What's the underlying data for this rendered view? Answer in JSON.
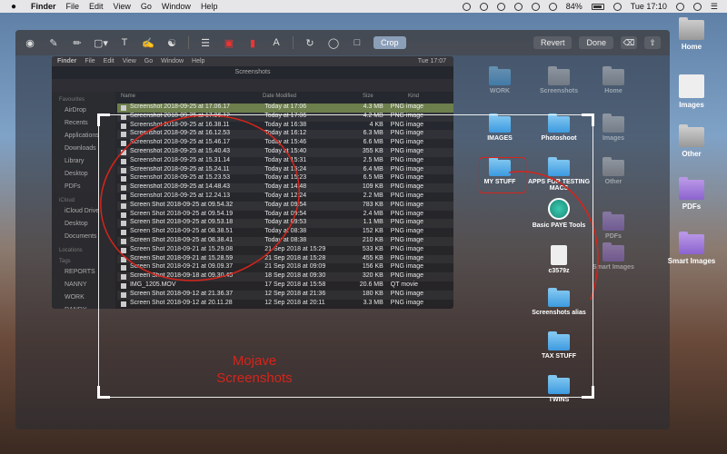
{
  "menubar": {
    "apple": "",
    "items": [
      "Finder",
      "File",
      "Edit",
      "View",
      "Go",
      "Window",
      "Help"
    ],
    "battery": "84%",
    "clock": "Tue 17:10"
  },
  "toolbar": {
    "crop_label": "Crop",
    "revert_label": "Revert",
    "done_label": "Done"
  },
  "finder": {
    "menu": [
      "Finder",
      "File",
      "Edit",
      "View",
      "Go",
      "Window",
      "Help"
    ],
    "title": "Screenshots",
    "clock": "Tue 17:07",
    "sidebar_sections": [
      {
        "header": "Favourites",
        "items": [
          "AirDrop",
          "Recents",
          "Applications",
          "Downloads",
          "Library",
          "Desktop",
          "PDFs"
        ]
      },
      {
        "header": "iCloud",
        "items": [
          "iCloud Drive",
          "Desktop",
          "Documents"
        ]
      },
      {
        "header": "Locations",
        "items": []
      },
      {
        "header": "Tags",
        "items": [
          "REPORTS",
          "NANNY",
          "WORK",
          "RANDY"
        ]
      }
    ],
    "columns": {
      "name": "Name",
      "date": "Date Modified",
      "size": "Size",
      "kind": "Kind"
    },
    "rows": [
      {
        "name": "Screenshot 2018-09-25 at 17.06.17",
        "date": "Today at 17:06",
        "size": "4.3 MB",
        "kind": "PNG image"
      },
      {
        "name": "Screenshot 2018-09-25 at 17.06.12",
        "date": "Today at 17:06",
        "size": "4.2 MB",
        "kind": "PNG image"
      },
      {
        "name": "Screenshot 2018-09-25 at 16.38.11",
        "date": "Today at 16:38",
        "size": "4 KB",
        "kind": "PNG image"
      },
      {
        "name": "Screenshot 2018-09-25 at 16.12.53",
        "date": "Today at 16:12",
        "size": "6.3 MB",
        "kind": "PNG image"
      },
      {
        "name": "Screenshot 2018-09-25 at 15.46.17",
        "date": "Today at 15:46",
        "size": "6.6 MB",
        "kind": "PNG image"
      },
      {
        "name": "Screenshot 2018-09-25 at 15.40.43",
        "date": "Today at 15:40",
        "size": "355 KB",
        "kind": "PNG image"
      },
      {
        "name": "Screenshot 2018-09-25 at 15.31.14",
        "date": "Today at 15:31",
        "size": "2.5 MB",
        "kind": "PNG image"
      },
      {
        "name": "Screenshot 2018-09-25 at 15.24.11",
        "date": "Today at 15:24",
        "size": "6.4 MB",
        "kind": "PNG image"
      },
      {
        "name": "Screenshot 2018-09-25 at 15.23.53",
        "date": "Today at 15:23",
        "size": "6.5 MB",
        "kind": "PNG image"
      },
      {
        "name": "Screenshot 2018-09-25 at 14.48.43",
        "date": "Today at 14:48",
        "size": "109 KB",
        "kind": "PNG image"
      },
      {
        "name": "Screenshot 2018-09-25 at 12.24.13",
        "date": "Today at 12:24",
        "size": "2.2 MB",
        "kind": "PNG image"
      },
      {
        "name": "Screen Shot 2018-09-25 at 09.54.32",
        "date": "Today at 09:54",
        "size": "783 KB",
        "kind": "PNG image"
      },
      {
        "name": "Screen Shot 2018-09-25 at 09.54.19",
        "date": "Today at 09:54",
        "size": "2.4 MB",
        "kind": "PNG image"
      },
      {
        "name": "Screen Shot 2018-09-25 at 09.53.18",
        "date": "Today at 09:53",
        "size": "1.1 MB",
        "kind": "PNG image"
      },
      {
        "name": "Screen Shot 2018-09-25 at 08.38.51",
        "date": "Today at 08:38",
        "size": "152 KB",
        "kind": "PNG image"
      },
      {
        "name": "Screen Shot 2018-09-25 at 08.38.41",
        "date": "Today at 08:38",
        "size": "210 KB",
        "kind": "PNG image"
      },
      {
        "name": "Screen Shot 2018-09-21 at 15.29.08",
        "date": "21 Sep 2018 at 15:29",
        "size": "533 KB",
        "kind": "PNG image"
      },
      {
        "name": "Screen Shot 2018-09-21 at 15.28.59",
        "date": "21 Sep 2018 at 15:28",
        "size": "455 KB",
        "kind": "PNG image"
      },
      {
        "name": "Screen Shot 2018-09-21 at 09.09.37",
        "date": "21 Sep 2018 at 09:09",
        "size": "156 KB",
        "kind": "PNG image"
      },
      {
        "name": "Screen Shot 2018-09-18 at 09.30.45",
        "date": "18 Sep 2018 at 09:30",
        "size": "320 KB",
        "kind": "PNG image"
      },
      {
        "name": "IMG_1205.MOV",
        "date": "17 Sep 2018 at 15:58",
        "size": "20.6 MB",
        "kind": "QT movie"
      },
      {
        "name": "Screen Shot 2018-09-12 at 21.36.37",
        "date": "12 Sep 2018 at 21:36",
        "size": "180 KB",
        "kind": "PNG image"
      },
      {
        "name": "Screen Shot 2018-09-12 at 20.11.28",
        "date": "12 Sep 2018 at 20:11",
        "size": "3.3 MB",
        "kind": "PNG image"
      }
    ]
  },
  "annotation": {
    "line1": "Mojave",
    "line2": "Screenshots"
  },
  "desktop_inner": {
    "items": [
      "WORK",
      "Screenshots",
      "Home",
      "IMAGES",
      "Photoshoot",
      "Images",
      "MY STUFF",
      "APPS FOR TESTING MACS",
      "Other",
      "Basic PAYE Tools",
      "PDFs",
      "c3579z",
      "Smart Images",
      "Screenshots alias",
      "TAX STUFF",
      "TWINS"
    ]
  },
  "desktop_right": {
    "items": [
      "Home",
      "Images",
      "Other",
      "PDFs",
      "Smart Images"
    ]
  }
}
